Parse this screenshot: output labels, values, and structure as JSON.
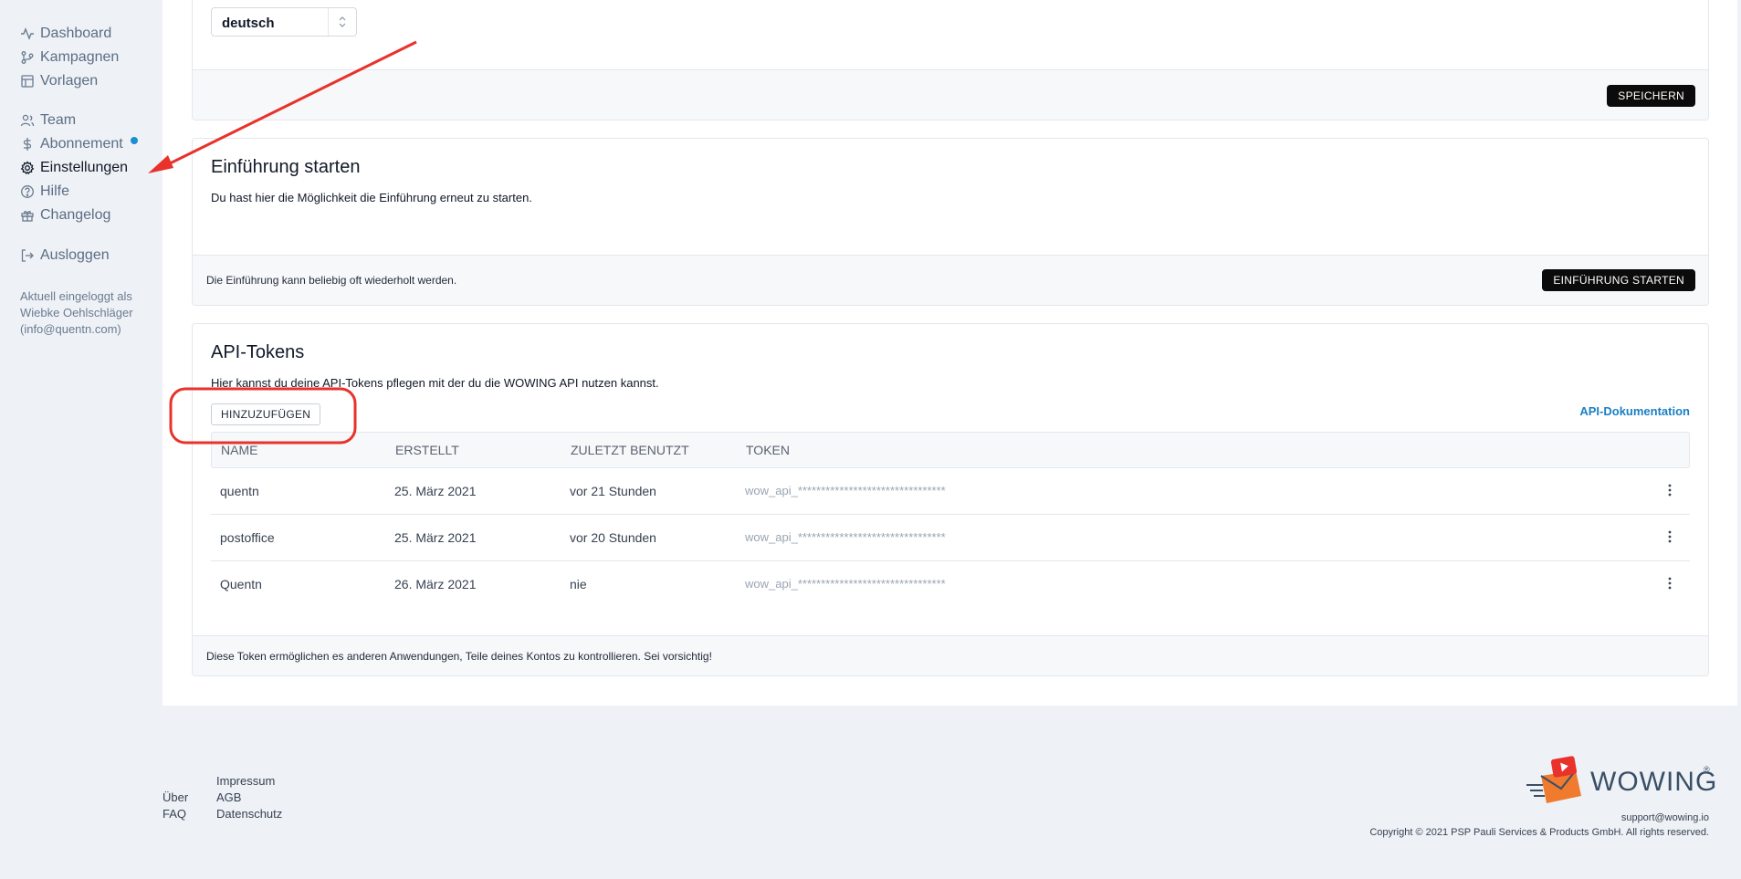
{
  "sidebar": {
    "items": [
      {
        "label": "Dashboard",
        "icon": "activity-icon"
      },
      {
        "label": "Kampagnen",
        "icon": "git-branch-icon"
      },
      {
        "label": "Vorlagen",
        "icon": "layout-icon"
      },
      {
        "label": "Team",
        "icon": "users-icon"
      },
      {
        "label": "Abonnement",
        "icon": "dollar-icon"
      },
      {
        "label": "Einstellungen",
        "icon": "gear-icon"
      },
      {
        "label": "Hilfe",
        "icon": "help-circle-icon"
      },
      {
        "label": "Changelog",
        "icon": "gift-icon"
      },
      {
        "label": "Ausloggen",
        "icon": "logout-icon"
      }
    ],
    "logged_in_line1": "Aktuell eingeloggt als",
    "logged_in_line2": "Wiebke Oehlschläger",
    "logged_in_line3": "(info@quentn.com)",
    "active_item": "Einstellungen"
  },
  "language": {
    "selected": "deutsch",
    "save_label": "SPEICHERN"
  },
  "intro": {
    "title": "Einführung starten",
    "description": "Du hast hier die Möglichkeit die Einführung erneut zu starten.",
    "footer_text": "Die Einführung kann beliebig oft wiederholt werden.",
    "button_label": "EINFÜHRUNG STARTEN"
  },
  "api": {
    "title": "API-Tokens",
    "description": "Hier kannst du deine API-Tokens pflegen mit der du die WOWING API nutzen kannst.",
    "add_label": "HINZUZUFÜGEN",
    "doc_link": "API-Dokumentation",
    "columns": [
      "NAME",
      "ERSTELLT",
      "ZULETZT BENUTZT",
      "TOKEN"
    ],
    "rows": [
      {
        "name": "quentn",
        "created": "25. März 2021",
        "last_used": "vor 21 Stunden",
        "token": "wow_api_********************************"
      },
      {
        "name": "postoffice",
        "created": "25. März 2021",
        "last_used": "vor 20 Stunden",
        "token": "wow_api_********************************"
      },
      {
        "name": "Quentn",
        "created": "26. März 2021",
        "last_used": "nie",
        "token": "wow_api_********************************"
      }
    ],
    "footer_text": "Diese Token ermöglichen es anderen Anwendungen, Teile deines Kontos zu kontrollieren. Sei vorsichtig!"
  },
  "footer": {
    "links_col1": [
      "Über",
      "FAQ"
    ],
    "links_col2": [
      "Impressum",
      "AGB",
      "Datenschutz"
    ],
    "brand": "WOWING",
    "support_email": "support@wowing.io",
    "copyright": "Copyright © 2021 PSP Pauli Services & Products GmbH. All rights reserved."
  },
  "colors": {
    "accent": "#1a8fd4",
    "annotation": "#e8322b"
  }
}
